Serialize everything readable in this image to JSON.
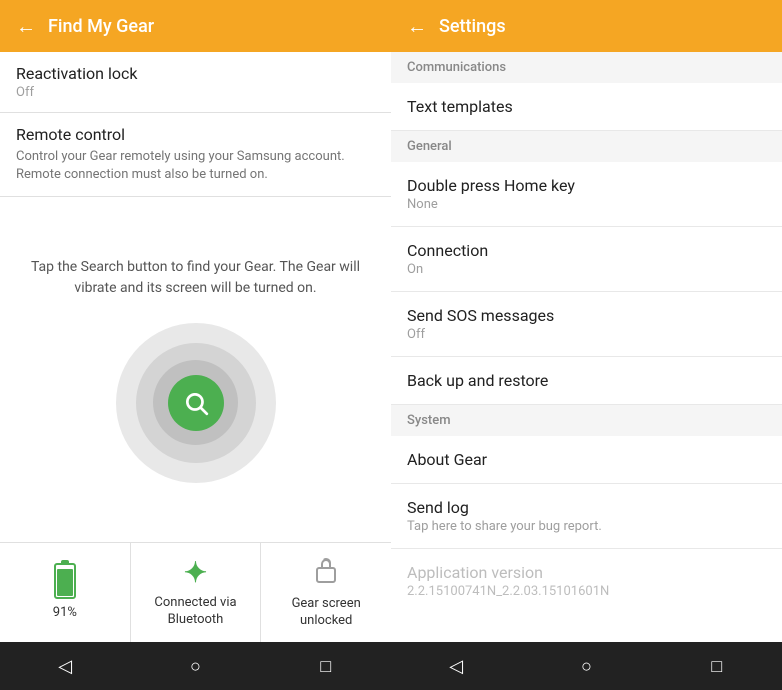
{
  "left": {
    "header": {
      "back_icon": "←",
      "title": "Find My Gear"
    },
    "reactivation_lock": {
      "title": "Reactivation lock",
      "status": "Off"
    },
    "remote_control": {
      "title": "Remote control",
      "description": "Control your Gear remotely using your Samsung account. Remote connection must also be turned on."
    },
    "search_description": "Tap the Search button to find your Gear. The Gear will vibrate and its screen will be turned on.",
    "status": {
      "battery": {
        "percent": "91%"
      },
      "bluetooth": {
        "label": "Connected via Bluetooth"
      },
      "lock": {
        "label": "Gear screen unlocked"
      }
    },
    "nav": {
      "back": "◁",
      "home": "○",
      "recent": "□"
    }
  },
  "right": {
    "header": {
      "back_icon": "←",
      "title": "Settings"
    },
    "sections": [
      {
        "label": "Communications",
        "items": [
          {
            "title": "Text templates",
            "sub": ""
          }
        ]
      },
      {
        "label": "General",
        "items": [
          {
            "title": "Double press Home key",
            "sub": "None"
          },
          {
            "title": "Connection",
            "sub": "On"
          },
          {
            "title": "Send SOS messages",
            "sub": "Off"
          },
          {
            "title": "Back up and restore",
            "sub": ""
          }
        ]
      },
      {
        "label": "System",
        "items": [
          {
            "title": "About Gear",
            "sub": ""
          },
          {
            "title": "Send log",
            "sub": "Tap here to share your bug report."
          }
        ]
      }
    ],
    "app_version": {
      "title": "Application version",
      "value": "2.2.15100741N_2.2.03.15101601N"
    },
    "nav": {
      "back": "◁",
      "home": "○",
      "recent": "□"
    }
  }
}
